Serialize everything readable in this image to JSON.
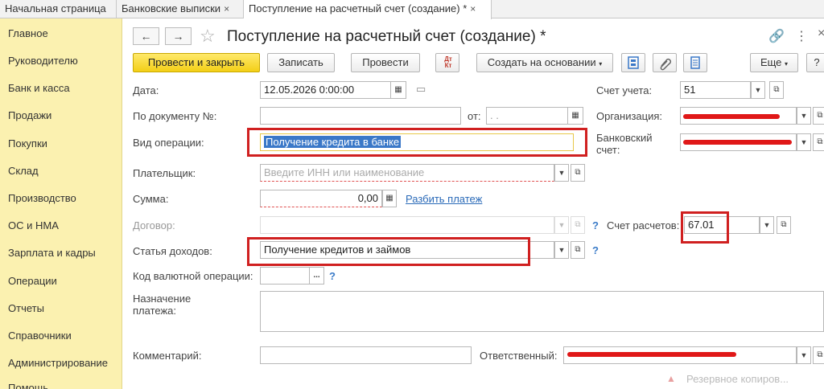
{
  "tabs": [
    {
      "label": "Начальная страница"
    },
    {
      "label": "Банковские выписки"
    },
    {
      "label": "Поступление на расчетный счет (создание) *"
    }
  ],
  "tab_close": "×",
  "sidebar": {
    "items": [
      {
        "label": "Главное"
      },
      {
        "label": "Руководителю"
      },
      {
        "label": "Банк и касса"
      },
      {
        "label": "Продажи"
      },
      {
        "label": "Покупки"
      },
      {
        "label": "Склад"
      },
      {
        "label": "Производство"
      },
      {
        "label": "ОС и НМА"
      },
      {
        "label": "Зарплата и кадры"
      },
      {
        "label": "Операции"
      },
      {
        "label": "Отчеты"
      },
      {
        "label": "Справочники"
      },
      {
        "label": "Администрирование"
      },
      {
        "label": "Помощь"
      }
    ]
  },
  "header": {
    "title": "Поступление на расчетный счет (создание) *",
    "back": "←",
    "forward": "→",
    "star": "☆",
    "link_icon": "🔗",
    "more_icon": "⋮"
  },
  "toolbar": {
    "post_close": "Провести и закрыть",
    "save": "Записать",
    "post": "Провести",
    "dt_kt": "Дт Кт",
    "create_based": "Создать на основании",
    "more": "Еще",
    "help": "?"
  },
  "form": {
    "date_label": "Дата:",
    "date_value": "12.05.2026  0:00:00",
    "doc_num_label": "По документу №:",
    "from_label": "от:",
    "from_value": " .  .",
    "op_type_label": "Вид операции:",
    "op_type_value": "Получение кредита в банке",
    "payer_label": "Плательщик:",
    "payer_placeholder": "Введите ИНН или наименование",
    "sum_label": "Сумма:",
    "sum_value": "0,00",
    "split_link": "Разбить платеж",
    "contract_label": "Договор:",
    "income_item_label": "Статья доходов:",
    "income_item_value": "Получение кредитов и займов",
    "currency_code_label": "Код валютной операции:",
    "currency_code_btn": "...",
    "purpose_label_1": "Назначение",
    "purpose_label_2": "платежа:",
    "comment_label": "Комментарий:",
    "responsible_label": "Ответственный:",
    "account_label": "Счет учета:",
    "account_value": "51",
    "org_label": "Организация:",
    "bank_account_label_1": "Банковский",
    "bank_account_label_2": "счет:",
    "settlement_account_label": "Счет расчетов:",
    "settlement_account_value": "67.01",
    "question": "?"
  },
  "notification": {
    "text": "Резервное копиров..."
  },
  "colors": {
    "sidebar_bg": "#fbf1b0",
    "primary_button": "#f3cf17",
    "annotation_red": "#d02020",
    "selection_blue": "#3a78c8",
    "link_blue": "#2a6ab8"
  }
}
